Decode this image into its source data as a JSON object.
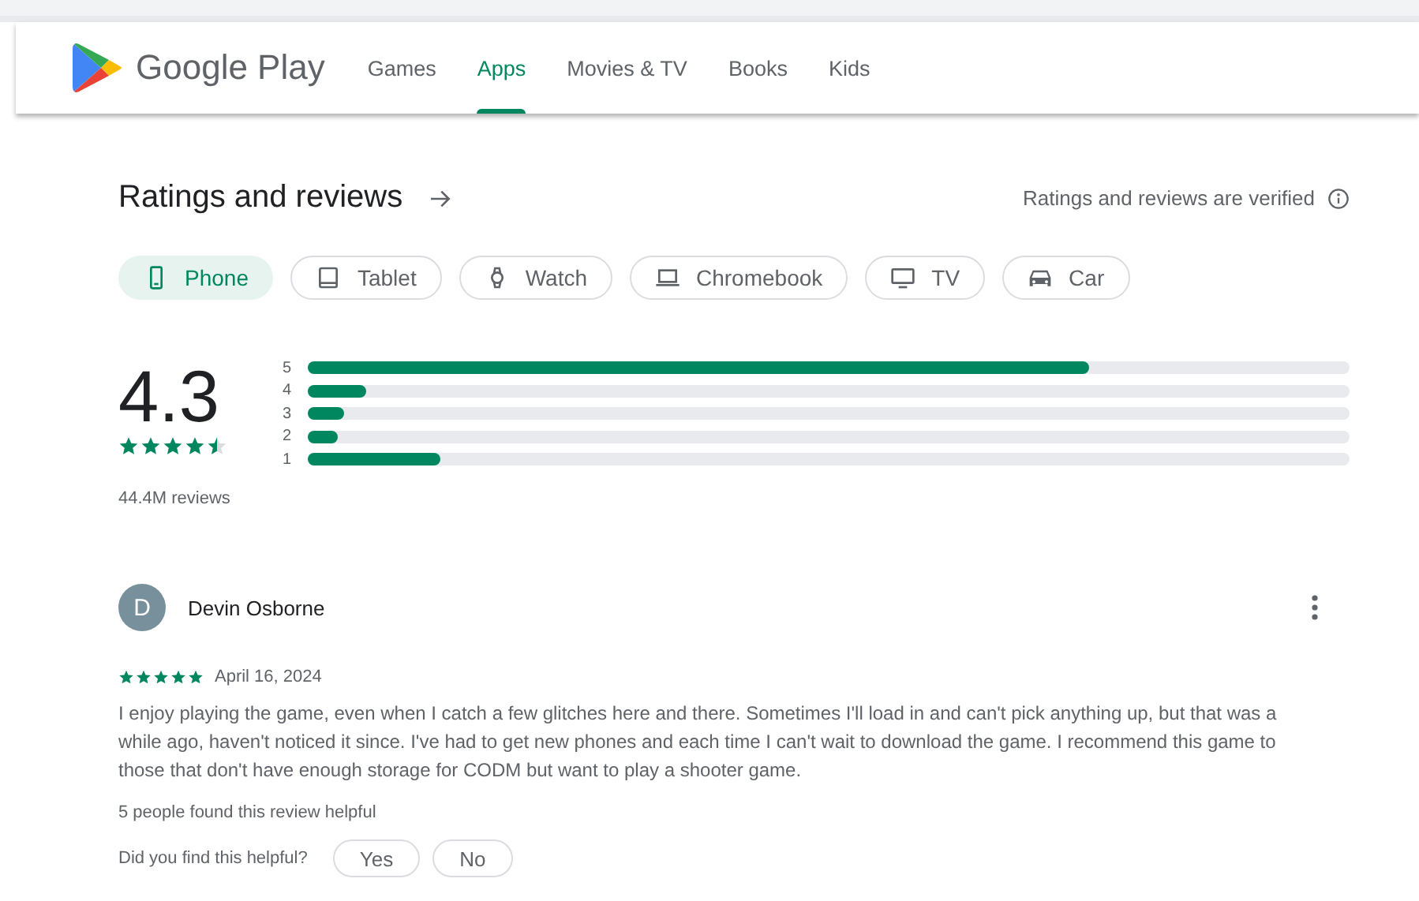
{
  "header": {
    "brand": "Google Play",
    "tabs": [
      {
        "label": "Games",
        "selected": false
      },
      {
        "label": "Apps",
        "selected": true
      },
      {
        "label": "Movies & TV",
        "selected": false
      },
      {
        "label": "Books",
        "selected": false
      },
      {
        "label": "Kids",
        "selected": false
      }
    ]
  },
  "ratings": {
    "title": "Ratings and reviews",
    "verified": "Ratings and reviews are verified",
    "devices": [
      {
        "label": "Phone",
        "kind": "phone",
        "selected": true
      },
      {
        "label": "Tablet",
        "kind": "tablet",
        "selected": false
      },
      {
        "label": "Watch",
        "kind": "watch",
        "selected": false
      },
      {
        "label": "Chromebook",
        "kind": "laptop",
        "selected": false
      },
      {
        "label": "TV",
        "kind": "tv",
        "selected": false
      },
      {
        "label": "Car",
        "kind": "car",
        "selected": false
      }
    ],
    "score": "4.3",
    "stars": 4.5,
    "count": "44.4M reviews",
    "bars": [
      {
        "label": "5",
        "level": 0.75
      },
      {
        "label": "4",
        "level": 0.056
      },
      {
        "label": "3",
        "level": 0.035
      },
      {
        "label": "2",
        "level": 0.029
      },
      {
        "label": "1",
        "level": 0.128
      }
    ]
  },
  "review": {
    "initial": "D",
    "name": "Devin Osborne",
    "stars": 5,
    "date": "April 16, 2024",
    "text": "I enjoy playing the game, even when I catch a few glitches here and there. Sometimes I'll load in and can't pick anything up, but that was a while ago, haven't noticed it since. I've had to get new phones and each time I can't wait to download the game. I recommend this game to those that don't have enough storage for CODM but want to play a shooter game.",
    "helpful": "5 people found this review helpful",
    "question": "Did you find this helpful?",
    "buttons": [
      "Yes",
      "No"
    ]
  }
}
